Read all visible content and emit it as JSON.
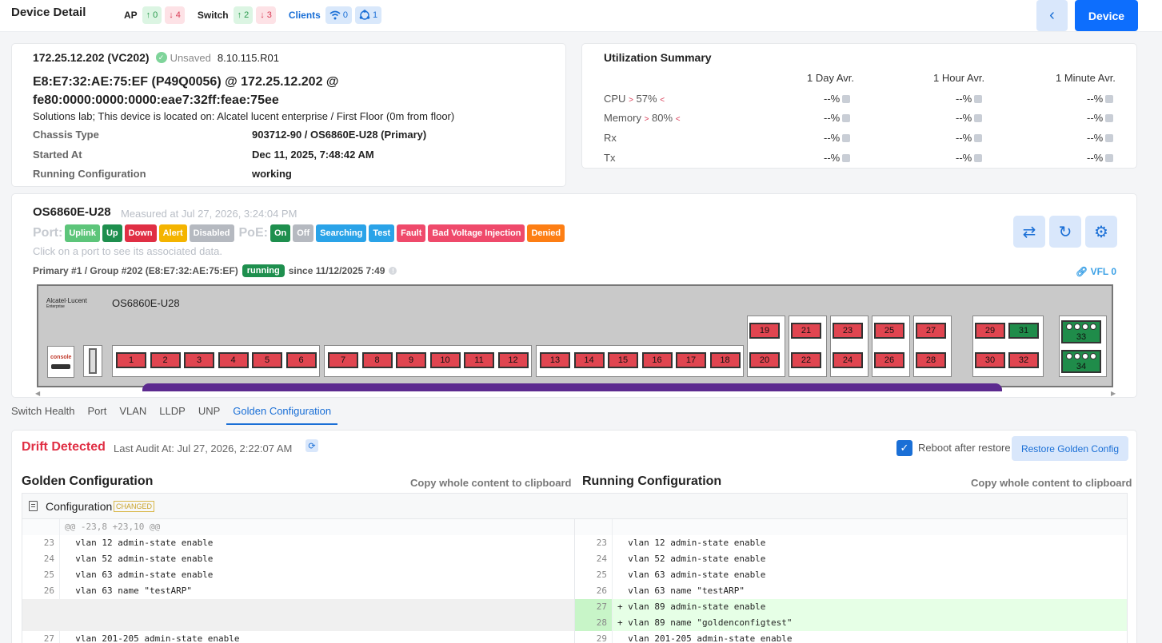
{
  "header": {
    "title": "Device Detail",
    "ap_label": "AP",
    "ap_up": "0",
    "ap_down": "4",
    "switch_label": "Switch",
    "switch_up": "2",
    "switch_down": "3",
    "clients_label": "Clients",
    "clients_wifi": "0",
    "clients_wired": "1",
    "device_button": "Device"
  },
  "device": {
    "name": "172.25.12.202 (VC202)",
    "status": "Unsaved",
    "firmware": "8.10.115.R01",
    "mac_line1": "E8:E7:32:AE:75:EF (P49Q0056) @ 172.25.12.202 @",
    "mac_line2": "fe80:0000:0000:0000:eae7:32ff:feae:75ee",
    "description": "Solutions lab; This device is located on: Alcatel lucent enterprise / First Floor (0m from floor)",
    "rows": [
      {
        "label": "Chassis Type",
        "value": "903712-90 / OS6860E-U28 (Primary)"
      },
      {
        "label": "Started At",
        "value": "Dec 11, 2025, 7:48:42 AM"
      },
      {
        "label": "Running Configuration",
        "value": "working"
      }
    ]
  },
  "utilization": {
    "title": "Utilization Summary",
    "cols": [
      "1 Day Avr.",
      "1 Hour Avr.",
      "1 Minute Avr."
    ],
    "rows": [
      {
        "label": "CPU",
        "thresh": "57%",
        "values": [
          "--%",
          "--%",
          "--%"
        ]
      },
      {
        "label": "Memory",
        "thresh": "80%",
        "values": [
          "--%",
          "--%",
          "--%"
        ]
      },
      {
        "label": "Rx",
        "thresh": "",
        "values": [
          "--%",
          "--%",
          "--%"
        ]
      },
      {
        "label": "Tx",
        "thresh": "",
        "values": [
          "--%",
          "--%",
          "--%"
        ]
      }
    ]
  },
  "chassis": {
    "model": "OS6860E-U28",
    "measured": "Measured at Jul 27, 2026, 3:24:04 PM",
    "port_label": "Port:",
    "poe_label": "PoE:",
    "port_states": [
      {
        "label": "Uplink",
        "color": "#5dc57a"
      },
      {
        "label": "Up",
        "color": "#1e8f4e"
      },
      {
        "label": "Down",
        "color": "#e02f44"
      },
      {
        "label": "Alert",
        "color": "#f4b400"
      },
      {
        "label": "Disabled",
        "color": "#b5b9c0"
      }
    ],
    "poe_states": [
      {
        "label": "On",
        "color": "#1e8f4e"
      },
      {
        "label": "Off",
        "color": "#b5b9c0"
      },
      {
        "label": "Searching",
        "color": "#2aa3e8"
      },
      {
        "label": "Test",
        "color": "#2aa3e8"
      },
      {
        "label": "Fault",
        "color": "#ef4a6b"
      },
      {
        "label": "Bad Voltage Injection",
        "color": "#ef4a6b"
      },
      {
        "label": "Denied",
        "color": "#fd7e14"
      }
    ],
    "hint": "Click on a port to see its associated data.",
    "primary": "Primary #1 / Group #202 (E8:E7:32:AE:75:EF)",
    "running": "running",
    "since": "since 11/12/2025 7:49",
    "vfl": "VFL 0",
    "brand": "Alcatel·Lucent",
    "brand_sub": "Enterprise",
    "chassis_model": "OS6860E-U28",
    "console": "console",
    "ports": [
      "1",
      "2",
      "3",
      "4",
      "5",
      "6",
      "7",
      "8",
      "9",
      "10",
      "11",
      "12",
      "13",
      "14",
      "15",
      "16",
      "17",
      "18",
      "19",
      "20",
      "21",
      "22",
      "23",
      "24",
      "25",
      "26",
      "27",
      "28",
      "29",
      "30",
      "31",
      "32"
    ],
    "sfp": [
      "33",
      "34"
    ]
  },
  "tabs": [
    "Switch Health",
    "Port",
    "VLAN",
    "LLDP",
    "UNP",
    "Golden Configuration"
  ],
  "golden": {
    "drift": "Drift Detected",
    "audit": "Last Audit At: Jul 27, 2026, 2:22:07 AM",
    "reboot_label": "Reboot after restore",
    "restore_button": "Restore Golden Config",
    "left_title": "Golden Configuration",
    "right_title": "Running Configuration",
    "copy_label": "Copy whole content to clipboard",
    "file_label": "Configuration",
    "changed": "CHANGED",
    "hunk": "@@ -23,8 +23,10 @@",
    "left_lines": [
      {
        "n": "23",
        "t": "  vlan 12 admin-state enable"
      },
      {
        "n": "24",
        "t": "  vlan 52 admin-state enable"
      },
      {
        "n": "25",
        "t": "  vlan 63 admin-state enable"
      },
      {
        "n": "26",
        "t": "  vlan 63 name \"testARP\""
      },
      {
        "n": "27",
        "t": "  vlan 201-205 admin-state enable"
      }
    ],
    "right_lines": [
      {
        "n": "23",
        "t": "  vlan 12 admin-state enable"
      },
      {
        "n": "24",
        "t": "  vlan 52 admin-state enable"
      },
      {
        "n": "25",
        "t": "  vlan 63 admin-state enable"
      },
      {
        "n": "26",
        "t": "  vlan 63 name \"testARP\""
      },
      {
        "n": "27",
        "t": "+ vlan 89 admin-state enable"
      },
      {
        "n": "28",
        "t": "+ vlan 89 name \"goldenconfigtest\""
      },
      {
        "n": "29",
        "t": "  vlan 201-205 admin-state enable"
      }
    ]
  }
}
